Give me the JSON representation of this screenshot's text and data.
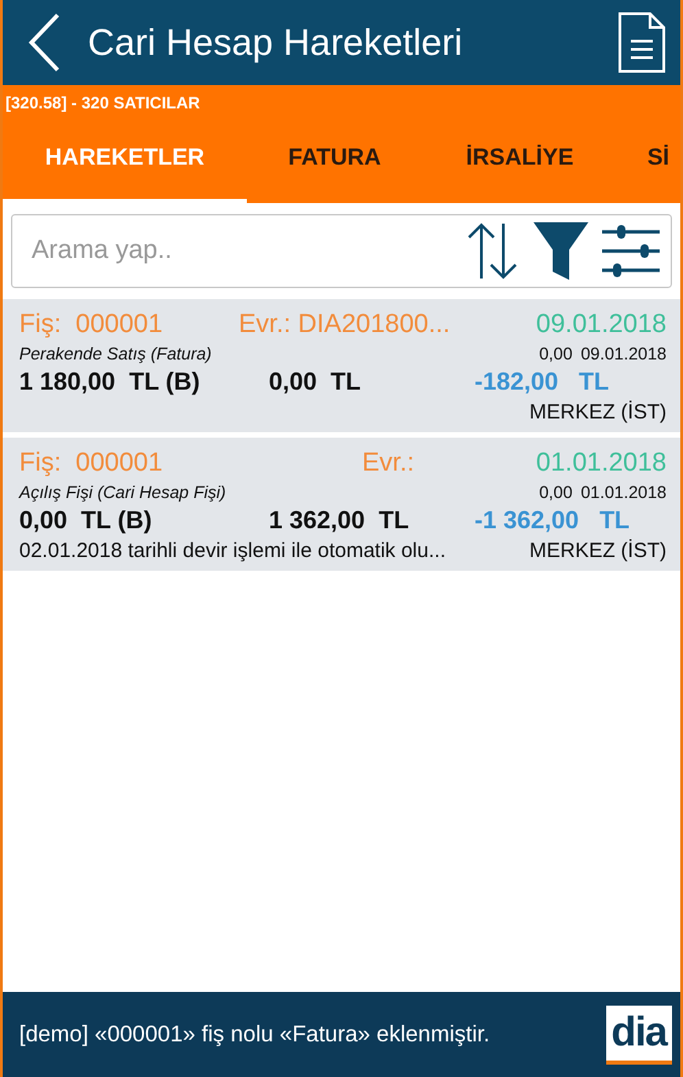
{
  "header": {
    "title": "Cari Hesap Hareketleri"
  },
  "account": "[320.58] - 320 SATICILAR",
  "tabs": [
    {
      "label": "HAREKETLER",
      "selected": true
    },
    {
      "label": "FATURA",
      "selected": false
    },
    {
      "label": "İRSALİYE",
      "selected": false
    },
    {
      "label": "Sİ",
      "selected": false
    }
  ],
  "search": {
    "placeholder": "Arama yap.."
  },
  "entries": [
    {
      "fis": "Fiş:  000001",
      "evr": "Evr.: DIA201800...",
      "date": "09.01.2018",
      "type": "Perakende Satış (Fatura)",
      "amount_small": "0,00",
      "date_small": "09.01.2018",
      "debit": "1 180,00  TL (B)",
      "credit": "0,00  TL",
      "balance": "-182,00   TL",
      "branch": "MERKEZ (İST)"
    },
    {
      "fis": "Fiş:  000001",
      "evr": "Evr.:",
      "date": "01.01.2018",
      "type": "Açılış Fişi (Cari Hesap Fişi)",
      "amount_small": "0,00",
      "date_small": "01.01.2018",
      "debit": "0,00  TL (B)",
      "credit": "1 362,00  TL",
      "balance": "-1 362,00   TL",
      "note": "02.01.2018 tarihli devir işlemi ile otomatik olu...",
      "branch": "MERKEZ (İST)"
    }
  ],
  "footer": {
    "message": "[demo] «000001» fiş nolu «Fatura» eklenmiştir.",
    "logo": "dia"
  }
}
